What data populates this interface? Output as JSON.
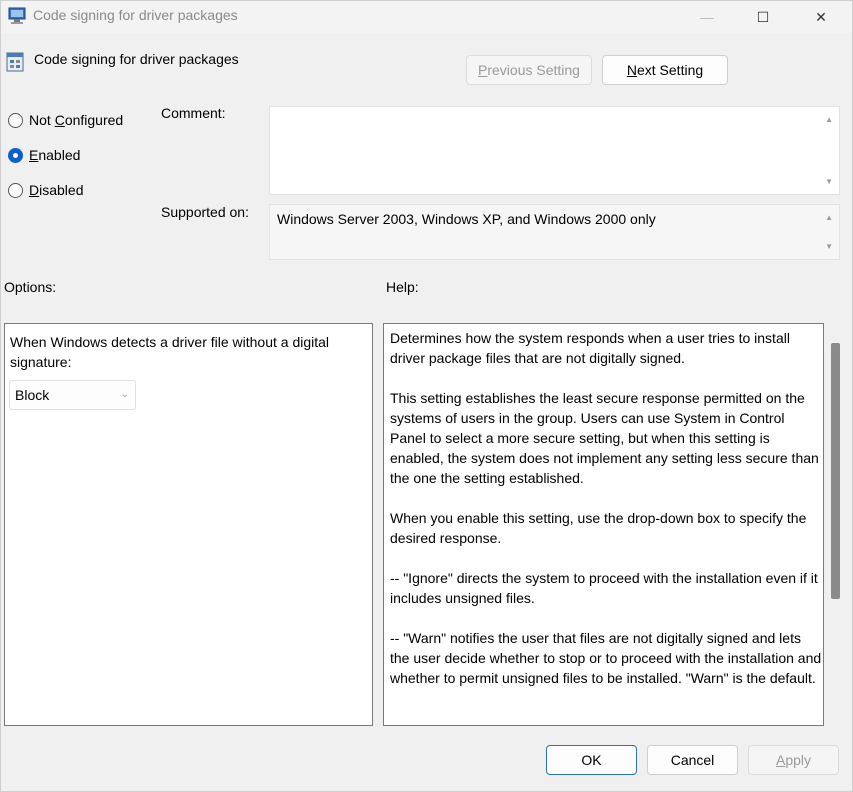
{
  "window": {
    "title": "Code signing for driver packages",
    "controls": {
      "minimize": "—",
      "maximize": "☐",
      "close": "✕"
    }
  },
  "header": {
    "policy_name": "Code signing for driver packages",
    "prev_button": {
      "pre": "",
      "underline": "P",
      "post": "revious Setting"
    },
    "next_button": {
      "pre": "",
      "underline": "N",
      "post": "ext Setting"
    }
  },
  "state": {
    "options": [
      {
        "pre": "Not ",
        "underline": "C",
        "post": "onfigured",
        "checked": false
      },
      {
        "pre": "",
        "underline": "E",
        "post": "nabled",
        "checked": true
      },
      {
        "pre": "",
        "underline": "D",
        "post": "isabled",
        "checked": false
      }
    ]
  },
  "labels": {
    "comment": "Comment:",
    "supported_on": "Supported on:",
    "options": "Options:",
    "help": "Help:"
  },
  "comment_value": "",
  "supported_on_value": "Windows Server 2003, Windows XP, and Windows 2000 only",
  "options_panel": {
    "prompt": "When Windows detects a driver file without a digital signature:",
    "dropdown_value": "Block"
  },
  "help_paragraphs": [
    "Determines how the system responds when a user tries to install driver package files that are not digitally signed.",
    "This setting establishes the least secure response permitted on the systems of users in the group. Users can use System in Control Panel to select a more secure setting, but when this setting is enabled, the system does not implement any setting less secure than the one the setting established.",
    "When you enable this setting, use the drop-down box to specify the desired response.",
    "--   \"Ignore\" directs the system to proceed with the installation even if it includes unsigned files.",
    "--   \"Warn\" notifies the user that files are not digitally signed and lets the user decide whether to stop or to proceed with the installation and whether to permit unsigned files to be installed. \"Warn\" is the default."
  ],
  "footer": {
    "ok": "OK",
    "cancel": "Cancel",
    "apply": {
      "pre": "",
      "underline": "A",
      "post": "pply"
    }
  }
}
